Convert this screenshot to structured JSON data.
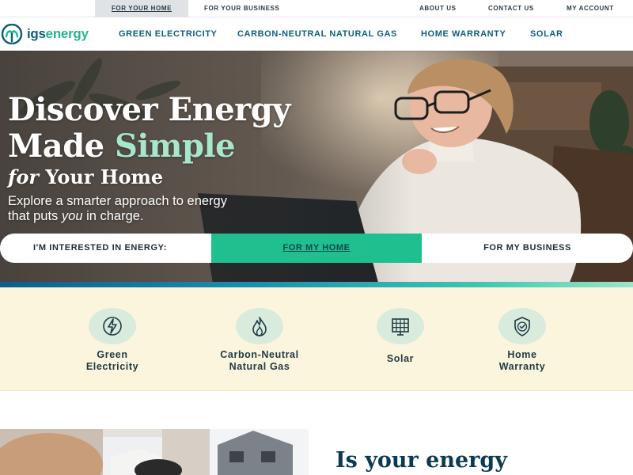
{
  "topbar": {
    "for_your_home": "FOR YOUR HOME",
    "for_your_business": "FOR YOUR BUSINESS",
    "about_us": "ABOUT US",
    "contact_us": "CONTACT US",
    "my_account": "MY ACCOUNT"
  },
  "logo": {
    "prefix": "igs",
    "suffix": "energy",
    "icon": "igs-leaf-logo-icon"
  },
  "nav": {
    "items": [
      {
        "label": "GREEN ELECTRICITY"
      },
      {
        "label": "CARBON-NEUTRAL NATURAL GAS"
      },
      {
        "label": "HOME WARRANTY"
      },
      {
        "label": "SOLAR"
      }
    ]
  },
  "hero": {
    "title_line1": "Discover Energy",
    "title_line2_a": "Made ",
    "title_line2_b": "Simple",
    "sub_italic": "for",
    "sub_rest": " Your Home",
    "desc_line1": "Explore a smarter approach to energy",
    "desc_line2_a": "that puts ",
    "desc_line2_em": "you",
    "desc_line2_b": " in charge."
  },
  "chooser": {
    "label": "I'M INTERESTED IN ENERGY:",
    "home": "FOR MY HOME",
    "business": "FOR MY BUSINESS"
  },
  "services": [
    {
      "line1": "Green",
      "line2": "Electricity",
      "icon": "lightning-icon"
    },
    {
      "line1": "Carbon-Neutral",
      "line2": "Natural Gas",
      "icon": "flame-icon"
    },
    {
      "line1": "Solar",
      "line2": "",
      "icon": "solar-panel-icon"
    },
    {
      "line1": "Home",
      "line2": "Warranty",
      "icon": "shield-check-icon"
    }
  ],
  "lower": {
    "heading": "Is your energy"
  },
  "colors": {
    "brand_blue": "#0f5e7a",
    "brand_green": "#1fbf8f",
    "hero_accent": "#a7e7cb",
    "services_bg": "#fbf5dd"
  }
}
